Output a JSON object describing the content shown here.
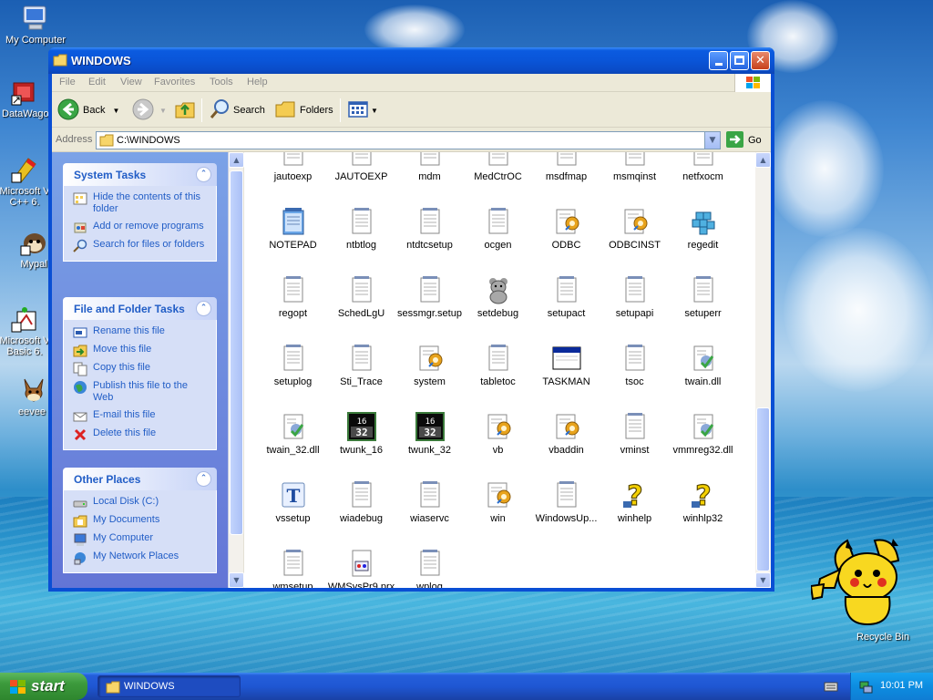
{
  "desktop": {
    "icons": [
      {
        "label": "My Computer",
        "icon": "my-computer-icon"
      },
      {
        "label": "DataWago",
        "icon": "datawagon-shortcut-icon"
      },
      {
        "label": "Microsoft V C++ 6.",
        "icon": "msvc-shortcut-icon"
      },
      {
        "label": "Mypal",
        "icon": "mypal-shortcut-icon"
      },
      {
        "label": "Microsoft V Basic 6.",
        "icon": "msvb-shortcut-icon"
      },
      {
        "label": "eevee",
        "icon": "eevee-icon"
      },
      {
        "label": "Recycle Bin",
        "icon": "recycle-bin-icon"
      }
    ]
  },
  "window": {
    "title": "WINDOWS",
    "menu": [
      "File",
      "Edit",
      "View",
      "Favorites",
      "Tools",
      "Help"
    ],
    "toolbar": {
      "back_label": "Back",
      "search_label": "Search",
      "folders_label": "Folders"
    },
    "address": {
      "label": "Address",
      "value": "C:\\WINDOWS",
      "go_label": "Go"
    }
  },
  "sidebar": {
    "system_tasks": {
      "title": "System Tasks",
      "items": [
        {
          "label": "Hide the contents of this folder",
          "icon": "hide-folder-icon"
        },
        {
          "label": "Add or remove programs",
          "icon": "add-remove-programs-icon"
        },
        {
          "label": "Search for files or folders",
          "icon": "search-icon"
        }
      ]
    },
    "file_tasks": {
      "title": "File and Folder Tasks",
      "items": [
        {
          "label": "Rename this file",
          "icon": "rename-icon"
        },
        {
          "label": "Move this file",
          "icon": "move-icon"
        },
        {
          "label": "Copy this file",
          "icon": "copy-icon"
        },
        {
          "label": "Publish this file to the Web",
          "icon": "publish-web-icon"
        },
        {
          "label": "E-mail this file",
          "icon": "email-icon"
        },
        {
          "label": "Delete this file",
          "icon": "delete-icon"
        }
      ]
    },
    "other_places": {
      "title": "Other Places",
      "items": [
        {
          "label": "Local Disk (C:)",
          "icon": "local-disk-icon"
        },
        {
          "label": "My Documents",
          "icon": "my-documents-icon"
        },
        {
          "label": "My Computer",
          "icon": "my-computer-icon"
        },
        {
          "label": "My Network Places",
          "icon": "network-places-icon"
        }
      ]
    }
  },
  "files": [
    {
      "name": "jautoexp",
      "type": "notepad"
    },
    {
      "name": "JAUTOEXP",
      "type": "notepad"
    },
    {
      "name": "mdm",
      "type": "notepad"
    },
    {
      "name": "MedCtrOC",
      "type": "notepad"
    },
    {
      "name": "msdfmap",
      "type": "notepad"
    },
    {
      "name": "msmqinst",
      "type": "notepad"
    },
    {
      "name": "netfxocm",
      "type": "notepad"
    },
    {
      "name": "NOTEPAD",
      "type": "notepad-app"
    },
    {
      "name": "ntbtlog",
      "type": "notepad"
    },
    {
      "name": "ntdtcsetup",
      "type": "notepad"
    },
    {
      "name": "ocgen",
      "type": "notepad"
    },
    {
      "name": "ODBC",
      "type": "config"
    },
    {
      "name": "ODBCINST",
      "type": "config"
    },
    {
      "name": "regedit",
      "type": "regedit"
    },
    {
      "name": "regopt",
      "type": "notepad"
    },
    {
      "name": "SchedLgU",
      "type": "notepad"
    },
    {
      "name": "sessmgr.setup",
      "type": "notepad"
    },
    {
      "name": "setdebug",
      "type": "bear"
    },
    {
      "name": "setupact",
      "type": "notepad"
    },
    {
      "name": "setupapi",
      "type": "notepad"
    },
    {
      "name": "setuperr",
      "type": "notepad"
    },
    {
      "name": "setuplog",
      "type": "notepad"
    },
    {
      "name": "Sti_Trace",
      "type": "notepad"
    },
    {
      "name": "system",
      "type": "config"
    },
    {
      "name": "tabletoc",
      "type": "notepad"
    },
    {
      "name": "TASKMAN",
      "type": "window-app"
    },
    {
      "name": "tsoc",
      "type": "notepad"
    },
    {
      "name": "twain.dll",
      "type": "dll"
    },
    {
      "name": "twain_32.dll",
      "type": "dll"
    },
    {
      "name": "twunk_16",
      "type": "twunk"
    },
    {
      "name": "twunk_32",
      "type": "twunk"
    },
    {
      "name": "vb",
      "type": "config"
    },
    {
      "name": "vbaddin",
      "type": "config"
    },
    {
      "name": "vminst",
      "type": "notepad"
    },
    {
      "name": "vmmreg32.dll",
      "type": "dll"
    },
    {
      "name": "vssetup",
      "type": "font"
    },
    {
      "name": "wiadebug",
      "type": "notepad"
    },
    {
      "name": "wiaservc",
      "type": "notepad"
    },
    {
      "name": "win",
      "type": "config"
    },
    {
      "name": "WindowsUp...",
      "type": "notepad"
    },
    {
      "name": "winhelp",
      "type": "help"
    },
    {
      "name": "winhlp32",
      "type": "help"
    },
    {
      "name": "wmsetup",
      "type": "notepad"
    },
    {
      "name": "WMSysPr9.prx",
      "type": "prx"
    },
    {
      "name": "wplog",
      "type": "notepad"
    }
  ],
  "taskbar": {
    "start_label": "start",
    "task_label": "WINDOWS",
    "clock": "10:01 PM"
  }
}
